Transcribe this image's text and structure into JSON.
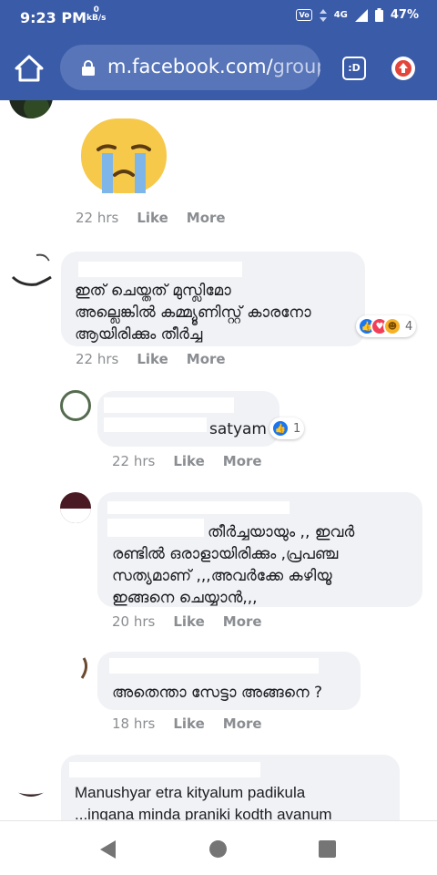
{
  "status_bar": {
    "time": "9:23 PM",
    "net_speed_value": "0",
    "net_speed_unit": "kB/s",
    "network": "4G",
    "volte": "Vo",
    "battery": "47%"
  },
  "browser": {
    "url_main": "m.facebook.com/",
    "url_rest": "group",
    "tabs_label": ":D"
  },
  "comments": [
    {
      "id": "emoji-crying",
      "time": "22 hrs",
      "like": "Like",
      "more": "More"
    },
    {
      "id": "muslim-comment",
      "lines": [
        "ഇത് ചെയ്തത് മുസ്ലിമോ",
        "അല്ലെങ്കിൽ കമ്മ്യൂണിസ്റ്റ് കാരനോ",
        "ആയിരിക്കും തീർച്ച"
      ],
      "reactions": [
        "like",
        "love",
        "haha"
      ],
      "reaction_count": "4",
      "time": "22 hrs",
      "like": "Like",
      "more": "More"
    },
    {
      "id": "satyam-reply",
      "lines": [
        "satyam"
      ],
      "reactions": [
        "like"
      ],
      "reaction_count": "1",
      "time": "22 hrs",
      "like": "Like",
      "more": "More"
    },
    {
      "id": "universe-reply",
      "lines": [
        "തീർച്ചയായും ,, ഇവർ",
        "രണ്ടിൽ ഒരാളായിരിക്കും ,പ്രപഞ്ച",
        "സത്യമാണ് ,,,അവർക്കേ കഴിയൂ",
        "ഇങ്ങനെ ചെയ്യാൻ,,,"
      ],
      "time": "20 hrs",
      "like": "Like",
      "more": "More"
    },
    {
      "id": "chetta-reply",
      "lines": [
        "അതെന്താ സേട്ടാ അങ്ങനെ ?"
      ],
      "time": "18 hrs",
      "like": "Like",
      "more": "More"
    },
    {
      "id": "manushyar-comment",
      "lines": [
        "Manushyar etra kityalum padikula",
        "...ingana minda praniki kodth avanum"
      ]
    }
  ],
  "colors": {
    "header": "#3a5ba8",
    "bubble": "#f0f2f5",
    "meta": "#8a8d91",
    "like_blue": "#1877f2"
  }
}
